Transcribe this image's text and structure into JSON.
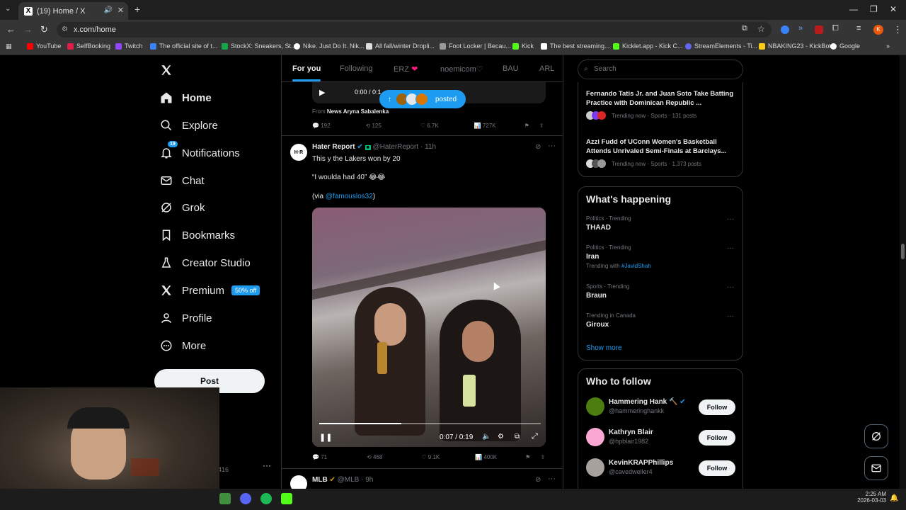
{
  "browser": {
    "tab_title": "(19) Home / X",
    "url": "x.com/home",
    "bookmarks": [
      "YouTube",
      "SelfBooking",
      "Twitch",
      "The official site of t...",
      "StockX: Sneakers, St...",
      "Nike. Just Do It. Nik...",
      "All fall/winter Dropli...",
      "Foot Locker | Becau...",
      "Kick",
      "The best streaming...",
      "Kicklet.app - Kick C...",
      "StreamElements - Ti...",
      "NBAKING23 - KickBot",
      "Google"
    ],
    "profile_initial": "K"
  },
  "sidebar": {
    "items": [
      {
        "label": "Home",
        "icon": "home-icon"
      },
      {
        "label": "Explore",
        "icon": "search-icon"
      },
      {
        "label": "Notifications",
        "icon": "bell-icon",
        "badge": "19"
      },
      {
        "label": "Chat",
        "icon": "mail-icon"
      },
      {
        "label": "Grok",
        "icon": "grok-icon"
      },
      {
        "label": "Bookmarks",
        "icon": "bookmark-icon"
      },
      {
        "label": "Creator Studio",
        "icon": "flask-icon"
      },
      {
        "label": "Premium",
        "icon": "x-logo-icon",
        "promo": "50% off"
      },
      {
        "label": "Profile",
        "icon": "person-icon"
      },
      {
        "label": "More",
        "icon": "more-circle-icon"
      }
    ],
    "post_label": "Post",
    "account_partial": "416"
  },
  "feed": {
    "tabs": [
      "For you",
      "Following",
      "ERZ",
      "noemicom♡",
      "BAU",
      "ARL"
    ],
    "posted_pill": "posted",
    "prev_post": {
      "video_time": "0:00 / 0:1",
      "from_label": "From",
      "from_name": "News Aryna Sabalenka",
      "replies": "192",
      "reposts": "125",
      "likes": "6.7K",
      "views": "727K"
    },
    "post": {
      "name": "Hater Report",
      "handle": "@HaterReport",
      "time": "11h",
      "line1": "This y the Lakers won by 20",
      "line2": "“I woulda had 40” 😂😂",
      "via_prefix": "(via ",
      "via_handle": "@famouslos32",
      "via_suffix": ")",
      "video_time": "0:07 / 0:19",
      "replies": "71",
      "reposts": "468",
      "likes": "9.1K",
      "views": "400K"
    },
    "next_post": {
      "name": "MLB",
      "handle": "@MLB",
      "time": "9h"
    }
  },
  "right": {
    "search_placeholder": "Search",
    "top_news": [
      {
        "title": "Fernando Tatis Jr. and Juan Soto Take Batting Practice with Dominican Republic ...",
        "meta": "Trending now · Sports · 131 posts"
      },
      {
        "title": "Azzi Fudd of UConn Women's Basketball Attends Unrivaled Semi-Finals at Barclays...",
        "meta": "Trending now · Sports · 1,373 posts"
      }
    ],
    "happening_title": "What's happening",
    "trends": [
      {
        "context": "Politics · Trending",
        "name": "THAAD",
        "extra": ""
      },
      {
        "context": "Politics · Trending",
        "name": "Iran",
        "extra_prefix": "Trending with ",
        "extra": "#JavidShah"
      },
      {
        "context": "Sports · Trending",
        "name": "Braun",
        "extra": ""
      },
      {
        "context": "Trending in Canada",
        "name": "Giroux",
        "extra": ""
      }
    ],
    "show_more": "Show more",
    "who_title": "Who to follow",
    "follow": [
      {
        "name": "Hammering Hank 🔨",
        "handle": "@hammeringhankk"
      },
      {
        "name": "Kathryn Blair",
        "handle": "@hpblair1982"
      },
      {
        "name": "KevinKRAPPhillips",
        "handle": "@cavedweller4"
      }
    ],
    "follow_label": "Follow"
  },
  "taskbar": {
    "time": "2:25 AM",
    "date": "2026-03-03"
  },
  "colors": {
    "accent": "#1d9bf0",
    "text": "#e7e9ea",
    "muted": "#71767b",
    "border": "#2f3336"
  }
}
